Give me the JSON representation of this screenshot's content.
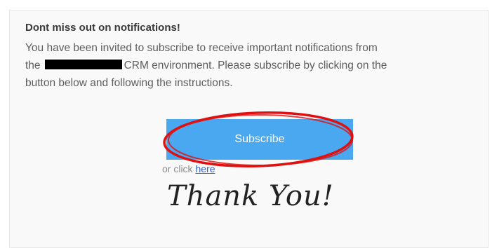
{
  "notice": {
    "heading": "Dont miss out on notifications!",
    "line1": "You have been invited to subscribe to receive important notifications from",
    "line2_pre": "the",
    "line2_post": "CRM environment. Please subscribe by clicking on the",
    "line3": "button below and following the instructions."
  },
  "subscribe": {
    "label": "Subscribe"
  },
  "alt_link": {
    "prefix": "or click ",
    "link_text": "here"
  },
  "signoff": {
    "text": "Thank You!"
  },
  "colors": {
    "button": "#49a8f0",
    "annotation_circle": "#e01010",
    "link": "#2f5fd0"
  }
}
